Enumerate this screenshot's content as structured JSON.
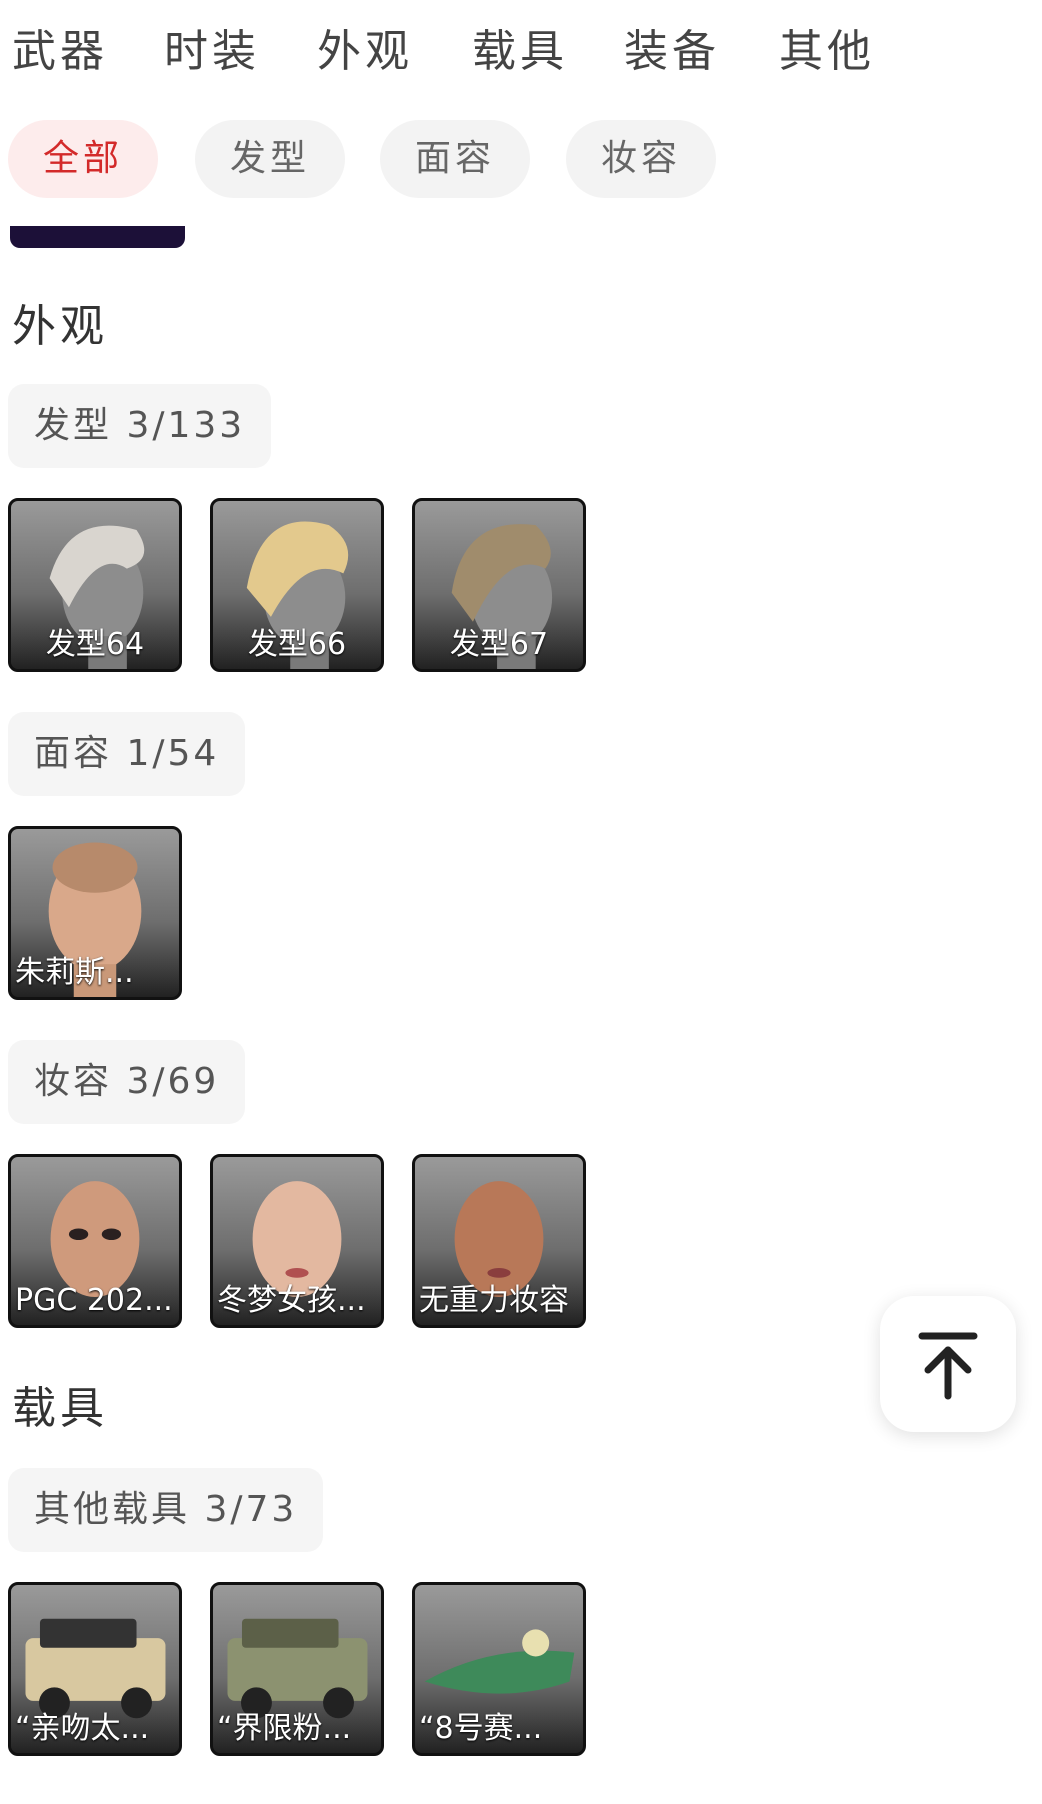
{
  "tabs": [
    "武器",
    "时装",
    "外观",
    "载具",
    "装备",
    "其他"
  ],
  "filters": [
    {
      "label": "全部",
      "active": true
    },
    {
      "label": "发型",
      "active": false
    },
    {
      "label": "面容",
      "active": false
    },
    {
      "label": "妆容",
      "active": false
    }
  ],
  "appearance": {
    "title": "外观",
    "hair": {
      "header": "发型 3/133",
      "items": [
        "发型64",
        "发型66",
        "发型67"
      ]
    },
    "face": {
      "header": "面容 1/54",
      "items": [
        "朱莉斯..."
      ]
    },
    "makeup": {
      "header": "妆容 3/69",
      "items": [
        "PGC 202...",
        "冬梦女孩...",
        "无重力妆容"
      ]
    }
  },
  "vehicles": {
    "title": "载具",
    "other": {
      "header": "其他载具 3/73",
      "items": [
        "“亲吻太...",
        "“界限粉...",
        "“8号赛..."
      ]
    }
  },
  "colors": {
    "accent": "#d32a2a",
    "chip_active_bg": "#fdecec",
    "chip_bg": "#f3f3f3",
    "card_border": "#111111",
    "banner": "#1c1038"
  },
  "icons": {
    "back_to_top": "arrow-up-to-line-icon"
  }
}
